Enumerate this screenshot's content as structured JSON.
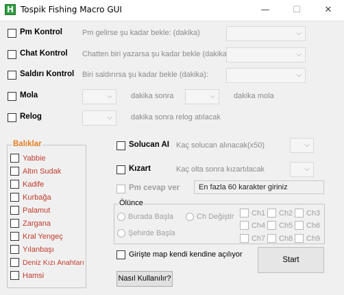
{
  "window": {
    "title": "Tospik Fishing Macro GUI",
    "icon_letter": "H",
    "minimize": "—",
    "maximize": "☐",
    "close": "✕"
  },
  "rows": {
    "pm": {
      "label": "Pm Kontrol",
      "hint": "Pm gelirse şu kadar bekle: (dakika)"
    },
    "chat": {
      "label": "Chat Kontrol",
      "hint": "Chatten biri yazarsa şu kadar bekle (dakika):"
    },
    "attack": {
      "label": "Saldırı Kontrol",
      "hint": "Biri saldırırsa şu kadar bekle (dakika):"
    },
    "break": {
      "label": "Mola",
      "after_text": "dakika sonra",
      "duration_text": "dakika mola"
    },
    "relog": {
      "label": "Relog",
      "text": "dakika sonra relog atılacak"
    }
  },
  "fish": {
    "title": "Balıklar",
    "items": [
      "Yabbie",
      "Altın Sudak",
      "Kadife",
      "Kurbağa",
      "Palamut",
      "Zargana",
      "Kral Yengeç",
      "Yılanbaşı",
      "Deniz Kızı Anahtarı",
      "Hamsi"
    ]
  },
  "worm": {
    "label": "Solucan AI",
    "hint": "Kaç solucan alınacak(x50)"
  },
  "fry": {
    "label": "Kızart",
    "hint": "Kaç olta sonra kızartılacak"
  },
  "pm_reply": {
    "label": "Pm cevap ver",
    "value": "En fazla 60 karakter giriniz"
  },
  "death": {
    "title": "Ölünce",
    "radio_here": "Burada Başla",
    "radio_change_ch": "Ch Değiştir",
    "radio_city": "Şehirde Başla",
    "channels": [
      "Ch1",
      "Ch2",
      "Ch3",
      "Ch4",
      "Ch5",
      "Ch6",
      "Ch7",
      "Ch8",
      "Ch9"
    ]
  },
  "map_open": {
    "label": "Girişte map kendi kendine açılıyor"
  },
  "buttons": {
    "start": "Start",
    "help": "Nasıl Kullanılır?"
  },
  "icons": {
    "dropdown": "chevron-down-icon"
  },
  "colors": {
    "fish_label": "#c0392b",
    "group_title_fish": "#e67e22",
    "app_icon": "#2e9e3e"
  }
}
